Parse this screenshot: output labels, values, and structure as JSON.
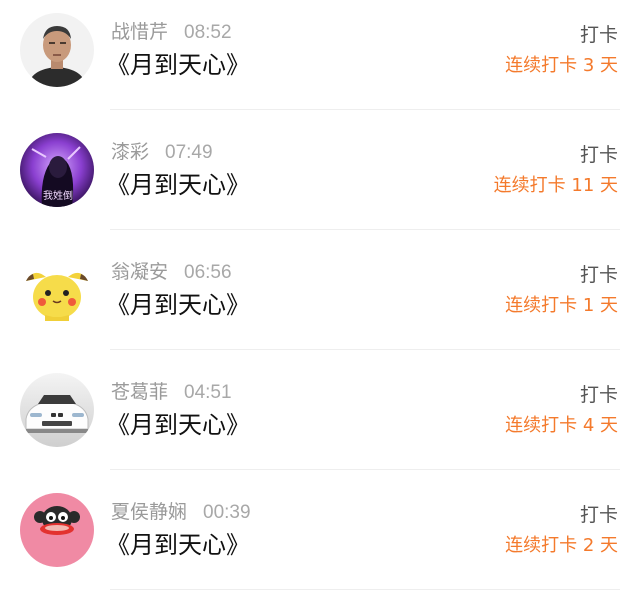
{
  "accent_color": "#f47a2c",
  "items": [
    {
      "name": "战惜芹",
      "time": "08:52",
      "title": "《月到天心》",
      "action": "打卡",
      "streak": "连续打卡 3 天",
      "avatar": "portrait-avatar"
    },
    {
      "name": "漆彩",
      "time": "07:49",
      "title": "《月到天心》",
      "action": "打卡",
      "streak": "连续打卡 11 天",
      "avatar": "purple-anime-avatar",
      "avatar_text": "我姓倒"
    },
    {
      "name": "翁凝安",
      "time": "06:56",
      "title": "《月到天心》",
      "action": "打卡",
      "streak": "连续打卡 1 天",
      "avatar": "pikachu-avatar"
    },
    {
      "name": "苍葛菲",
      "time": "04:51",
      "title": "《月到天心》",
      "action": "打卡",
      "streak": "连续打卡 4 天",
      "avatar": "white-car-avatar"
    },
    {
      "name": "夏侯静娴",
      "time": "00:39",
      "title": "《月到天心》",
      "action": "打卡",
      "streak": "连续打卡 2 天",
      "avatar": "monkey-avatar"
    }
  ]
}
